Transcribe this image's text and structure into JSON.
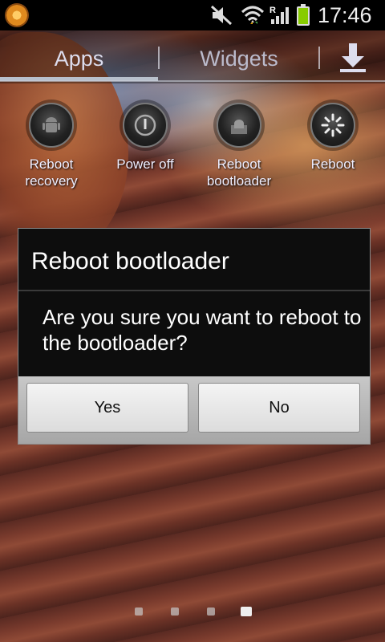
{
  "status_bar": {
    "time": "17:46",
    "roaming_indicator": "R",
    "icons": [
      "app-notification-icon",
      "mute-icon",
      "wifi-icon",
      "signal-icon",
      "battery-icon"
    ],
    "battery_color": "#88cc00"
  },
  "tabs": [
    {
      "label": "Apps",
      "selected": true
    },
    {
      "label": "Widgets",
      "selected": false
    }
  ],
  "apps": [
    {
      "label": "Reboot recovery",
      "icon": "android-icon"
    },
    {
      "label": "Power off",
      "icon": "power-icon"
    },
    {
      "label": "Reboot bootloader",
      "icon": "android-box-icon"
    },
    {
      "label": "Reboot",
      "icon": "spinner-icon"
    }
  ],
  "dialog": {
    "title": "Reboot bootloader",
    "message": "Are you sure you want to reboot to the bootloader?",
    "yes_label": "Yes",
    "no_label": "No"
  },
  "page_indicator": {
    "count": 4,
    "current": 4
  }
}
